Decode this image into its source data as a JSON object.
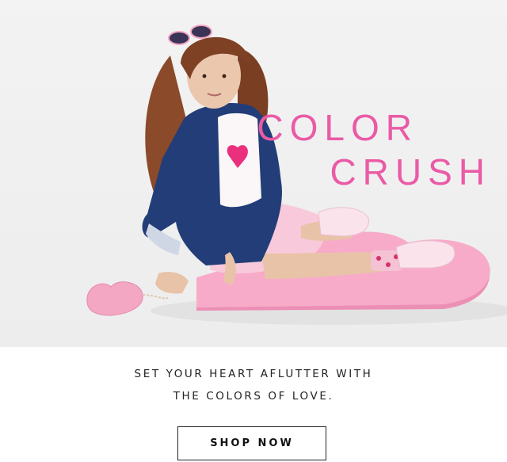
{
  "hero": {
    "headline_line1": "COLOR",
    "headline_line2": "CRUSH"
  },
  "body_copy": {
    "line1": "SET YOUR HEART AFLUTTER WITH",
    "line2": "THE COLORS OF LOVE."
  },
  "cta": {
    "label": "SHOP NOW"
  },
  "colors": {
    "accent_pink": "#ea5aa6",
    "heart_platform": "#f6a8c7",
    "denim": "#213b73"
  }
}
